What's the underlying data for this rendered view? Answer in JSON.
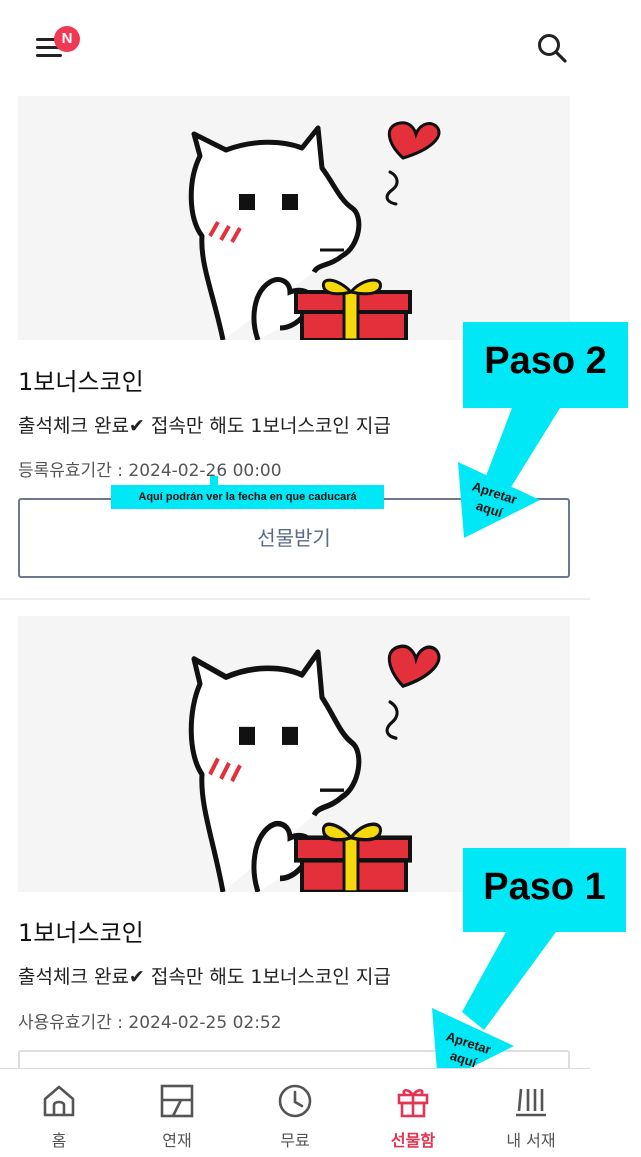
{
  "header": {
    "menu_badge": "N",
    "menu_icon": "hamburger-menu-icon",
    "search_icon": "search-icon"
  },
  "cards": [
    {
      "title": "1보너스코인",
      "description": "출석체크 완료✔ 접속만 해도 1보너스코인 지급",
      "expiry": "등록유효기간 : 2024-02-26 00:00",
      "button_label": "선물받기"
    },
    {
      "title": "1보너스코인",
      "description": "출석체크 완료✔ 접속만 해도 1보너스코인 지급",
      "expiry": "사용유효기간 : 2024-02-25 02:52"
    }
  ],
  "annotations": {
    "tooltip": "Aquí podrán ver la fecha en que caducará",
    "step2": "Paso 2",
    "step1": "Paso 1",
    "press_line1": "Apretar",
    "press_line2": "aquí"
  },
  "bottom_nav": [
    {
      "label": "홈",
      "icon": "home-icon"
    },
    {
      "label": "연재",
      "icon": "serial-icon"
    },
    {
      "label": "무료",
      "icon": "clock-icon"
    },
    {
      "label": "선물함",
      "icon": "gift-icon",
      "active": true
    },
    {
      "label": "내 서재",
      "icon": "library-icon"
    }
  ],
  "colors": {
    "accent": "#e23553",
    "annotation": "#00e8f5",
    "badge": "#f03a55",
    "button_border": "#6c7891"
  }
}
